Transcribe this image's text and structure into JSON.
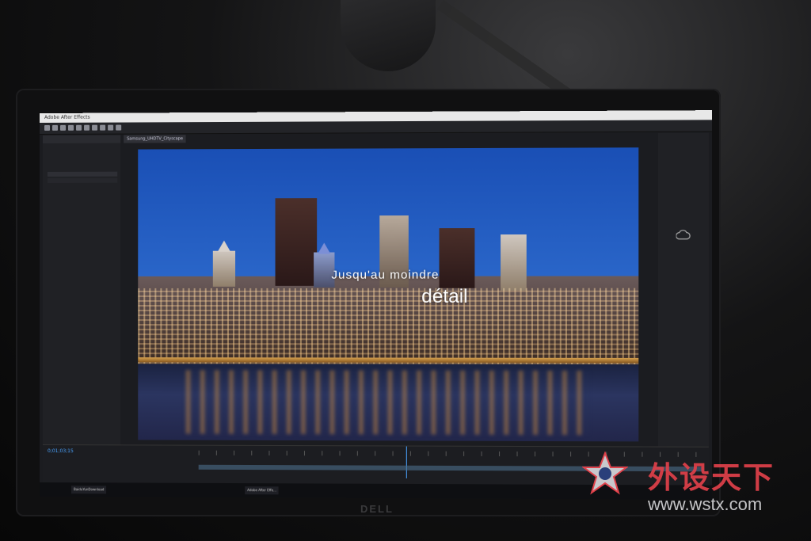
{
  "app": {
    "window_title": "Adobe After Effects",
    "comp_tab": "Samsung_UHDTV_Cityscape",
    "timecode": "0;01;03;15",
    "taskbar_items": [
      "BaiduYunDownload",
      "Adobe After Effe..."
    ]
  },
  "video_overlay": {
    "line1": "Jusqu'au moindre",
    "line2": "détail"
  },
  "monitor": {
    "brand": "DELL"
  },
  "watermark": {
    "text": "外设天下",
    "url": "www.wstx.com",
    "color": "#e0414a"
  },
  "icons": [
    "star-logo-icon",
    "search-icon"
  ]
}
